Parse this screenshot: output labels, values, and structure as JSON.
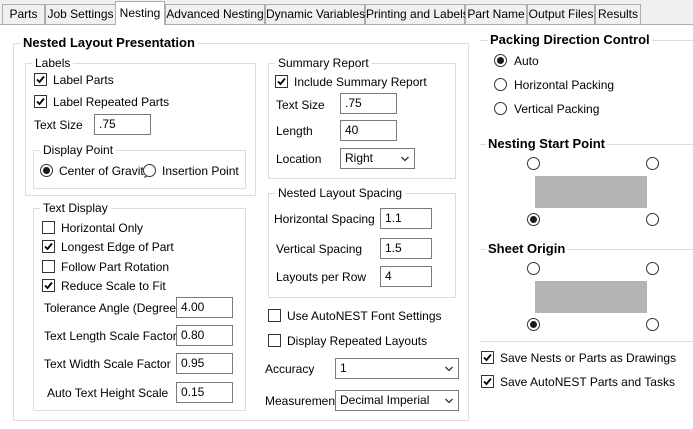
{
  "tabs": [
    {
      "label": "Parts"
    },
    {
      "label": "Job Settings"
    },
    {
      "label": "Nesting"
    },
    {
      "label": "Advanced Nesting"
    },
    {
      "label": "Dynamic Variables"
    },
    {
      "label": "Printing and Labels"
    },
    {
      "label": "Part Name"
    },
    {
      "label": "Output Files"
    },
    {
      "label": "Results"
    }
  ],
  "active_tab": "Nesting",
  "nested_layout": {
    "title": "Nested Layout Presentation",
    "labels": {
      "title": "Labels",
      "label_parts": {
        "label": "Label Parts",
        "checked": true
      },
      "label_repeated_parts": {
        "label": "Label Repeated Parts",
        "checked": true
      },
      "text_size_label": "Text Size",
      "text_size_value": ".75",
      "display_point": {
        "title": "Display Point",
        "center_of_gravity": {
          "label": "Center of Gravity",
          "selected": true
        },
        "insertion_point": {
          "label": "Insertion Point",
          "selected": false
        }
      }
    },
    "text_display": {
      "title": "Text Display",
      "horizontal_only": {
        "label": "Horizontal Only",
        "checked": false
      },
      "longest_edge": {
        "label": "Longest Edge of Part",
        "checked": true
      },
      "follow_rotation": {
        "label": "Follow Part Rotation",
        "checked": false
      },
      "reduce_scale": {
        "label": "Reduce Scale to Fit",
        "checked": true
      },
      "tolerance_angle_label": "Tolerance Angle (Degrees)",
      "tolerance_angle_value": "4.00",
      "text_length_label": "Text Length Scale Factor",
      "text_length_value": "0.80",
      "text_width_label": "Text Width Scale Factor",
      "text_width_value": "0.95",
      "auto_height_label": "Auto Text Height Scale",
      "auto_height_value": "0.15"
    },
    "summary_report": {
      "title": "Summary Report",
      "include": {
        "label": "Include Summary Report",
        "checked": true
      },
      "text_size_label": "Text Size",
      "text_size_value": ".75",
      "length_label": "Length",
      "length_value": "40",
      "location_label": "Location",
      "location_value": "Right"
    },
    "spacing": {
      "title": "Nested Layout Spacing",
      "horizontal_label": "Horizontal Spacing",
      "horizontal_value": "1.1",
      "vertical_label": "Vertical Spacing",
      "vertical_value": "1.5",
      "layouts_label": "Layouts per Row",
      "layouts_value": "4"
    },
    "use_font": {
      "label": "Use AutoNEST Font Settings",
      "checked": false
    },
    "display_repeated": {
      "label": "Display Repeated Layouts",
      "checked": false
    },
    "accuracy_label": "Accuracy",
    "accuracy_value": "1",
    "measurement_label": "Measurement",
    "measurement_value": "Decimal Imperial"
  },
  "packing": {
    "title": "Packing Direction Control",
    "auto": {
      "label": "Auto",
      "selected": true
    },
    "horizontal": {
      "label": "Horizontal Packing",
      "selected": false
    },
    "vertical": {
      "label": "Vertical Packing",
      "selected": false
    }
  },
  "nesting_start": {
    "title": "Nesting Start Point",
    "selected_corner": "bottom-left"
  },
  "sheet_origin": {
    "title": "Sheet Origin",
    "selected_corner": "bottom-left"
  },
  "save_nests": {
    "label": "Save Nests or Parts as Drawings",
    "checked": true
  },
  "save_parts": {
    "label": "Save AutoNEST Parts and Tasks",
    "checked": true
  },
  "icons": {
    "check": "check-icon",
    "dropdown": "chevron-down-icon"
  }
}
